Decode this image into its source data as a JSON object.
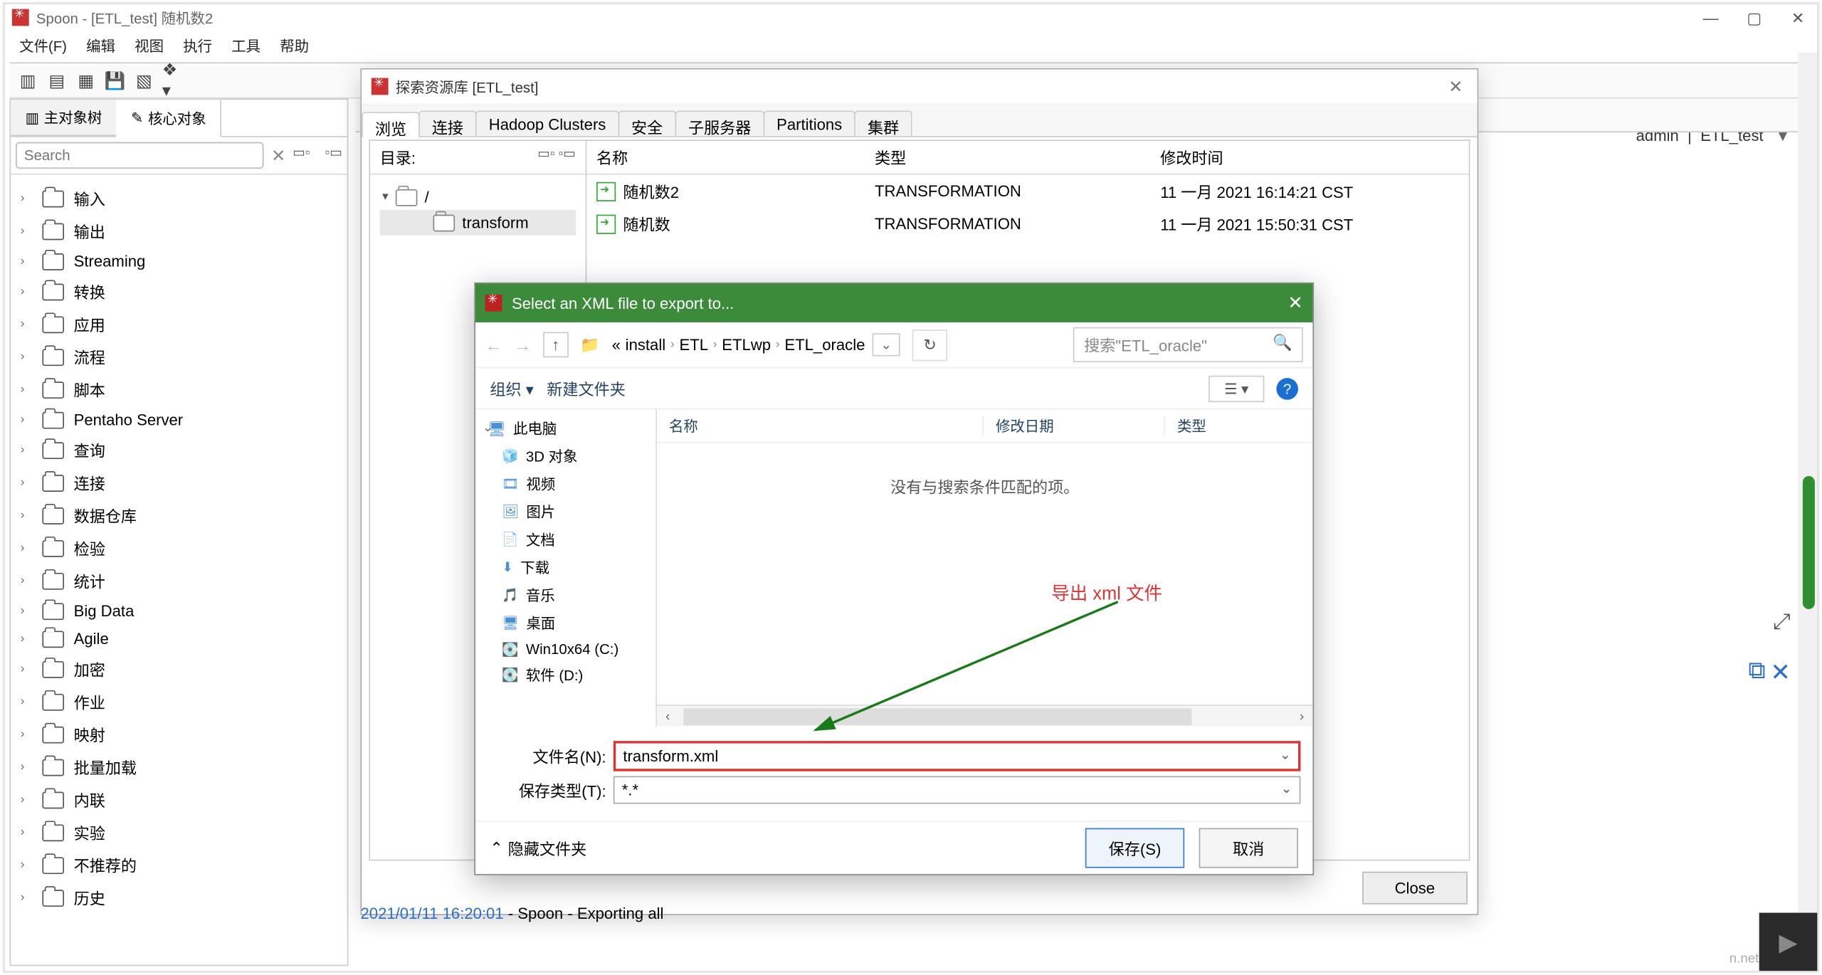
{
  "window": {
    "title": "Spoon - [ETL_test] 随机数2",
    "min": "—",
    "max": "▢",
    "close": "✕"
  },
  "menu": [
    "文件(F)",
    "编辑",
    "视图",
    "执行",
    "工具",
    "帮助"
  ],
  "user_chip": {
    "name": "admin",
    "sep": "|",
    "repo": "ETL_test"
  },
  "left_tabs": {
    "main": "主对象树",
    "core": "核心对象"
  },
  "search_placeholder": "Search",
  "categories": [
    "输入",
    "输出",
    "Streaming",
    "转换",
    "应用",
    "流程",
    "脚本",
    "Pentaho Server",
    "查询",
    "连接",
    "数据仓库",
    "检验",
    "统计",
    "Big Data",
    "Agile",
    "加密",
    "作业",
    "映射",
    "批量加载",
    "内联",
    "实验",
    "不推荐的",
    "历史"
  ],
  "repo": {
    "title": "探索资源库 [ETL_test]",
    "tabs": [
      "浏览",
      "连接",
      "Hadoop Clusters",
      "安全",
      "子服务器",
      "Partitions",
      "集群"
    ],
    "dir_label": "目录:",
    "root": "/",
    "subdir": "transform",
    "columns": {
      "name": "名称",
      "type": "类型",
      "mtime": "修改时间"
    },
    "rows": [
      {
        "name": "随机数2",
        "type": "TRANSFORMATION",
        "mtime": "11 一月 2021 16:14:21 CST"
      },
      {
        "name": "随机数",
        "type": "TRANSFORMATION",
        "mtime": "11 一月 2021 15:50:31 CST"
      }
    ],
    "close_btn": "Close"
  },
  "file_dialog": {
    "title": "Select an XML file to export to...",
    "crumbs": [
      "install",
      "ETL",
      "ETLwp",
      "ETL_oracle"
    ],
    "search_placeholder": "搜索\"ETL_oracle\"",
    "organize": "组织",
    "newfolder": "新建文件夹",
    "list_cols": {
      "name": "名称",
      "mtime": "修改日期",
      "type": "类型"
    },
    "empty_msg": "没有与搜索条件匹配的项。",
    "navtree": [
      {
        "label": "此电脑",
        "root": true
      },
      {
        "label": "3D 对象"
      },
      {
        "label": "视频"
      },
      {
        "label": "图片"
      },
      {
        "label": "文档"
      },
      {
        "label": "下载"
      },
      {
        "label": "音乐"
      },
      {
        "label": "桌面"
      },
      {
        "label": "Win10x64 (C:)"
      },
      {
        "label": "软件 (D:)"
      }
    ],
    "filename_label": "文件名(N):",
    "filename_value": "transform.xml",
    "savetype_label": "保存类型(T):",
    "savetype_value": "*.*",
    "hide_folders": "隐藏文件夹",
    "save_btn": "保存(S)",
    "cancel_btn": "取消"
  },
  "annotation": "导出 xml 文件",
  "log": {
    "ts": "2021/01/11 16:20:01",
    "msg": " - Spoon - Exporting all"
  },
  "watermark": "n.net/YKenan"
}
